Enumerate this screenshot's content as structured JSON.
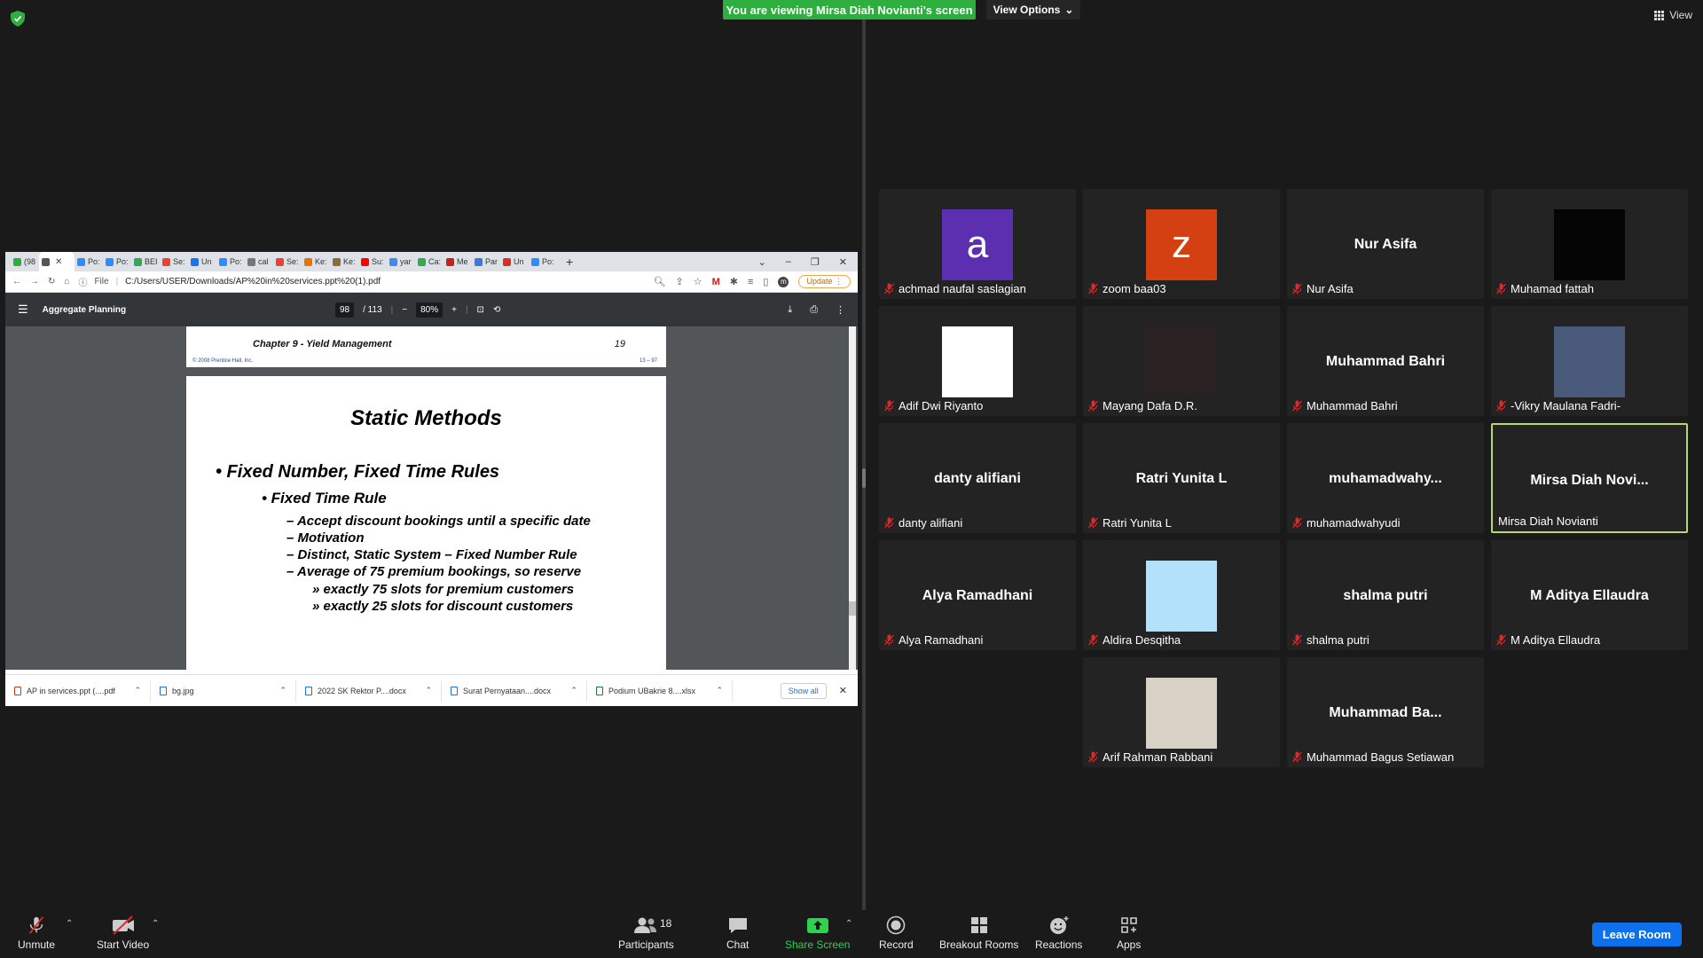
{
  "banner": {
    "viewing_text": "You are viewing Mirsa Diah Novianti's screen",
    "view_options_label": "View Options",
    "view_label": "View"
  },
  "browser": {
    "tabs": [
      {
        "label": "(98",
        "color": "#2dae3e"
      },
      {
        "label": "",
        "color": "#555555"
      },
      {
        "label": "Po:",
        "color": "#2d8cff"
      },
      {
        "label": "Po:",
        "color": "#2d8cff"
      },
      {
        "label": "BEI",
        "color": "#34a853"
      },
      {
        "label": "Se:",
        "color": "#ea4335"
      },
      {
        "label": "Un",
        "color": "#1a73e8"
      },
      {
        "label": "Po:",
        "color": "#2d8cff"
      },
      {
        "label": "cal",
        "color": "#777777"
      },
      {
        "label": "Se:",
        "color": "#ea4335"
      },
      {
        "label": "Ke:",
        "color": "#e37400"
      },
      {
        "label": "Ke:",
        "color": "#8a6d3b"
      },
      {
        "label": "Su:",
        "color": "#ff0000"
      },
      {
        "label": "yar",
        "color": "#4285f4"
      },
      {
        "label": "Ca:",
        "color": "#34a853"
      },
      {
        "label": "Me",
        "color": "#c5221f"
      },
      {
        "label": "Par",
        "color": "#3c78d8"
      },
      {
        "label": "Un",
        "color": "#d93025"
      },
      {
        "label": "Po:",
        "color": "#2d8cff"
      }
    ],
    "url_prefix": "File",
    "url": "C:/Users/USER/Downloads/AP%20in%20services.ppt%20(1).pdf",
    "update_label": "Update",
    "pdf": {
      "title": "Aggregate Planning",
      "page_current": "98",
      "page_total": "/ 113",
      "zoom": "80%",
      "prev_page": {
        "chapter": "Chapter 9 - Yield Management",
        "number": "19",
        "copyright": "© 2008 Prentice Hall, Inc.",
        "page_ref": "13 – 97"
      },
      "slide": {
        "title": "Static Methods",
        "bullet1": "•  Fixed Number, Fixed Time Rules",
        "bullet2": "•  Fixed Time Rule",
        "sub_items": [
          "– Accept discount bookings until a specific date",
          "– Motivation",
          "– Distinct, Static System – Fixed Number Rule",
          "– Average of 75 premium bookings, so reserve"
        ],
        "sub_sub_items": [
          "» exactly 75 slots for premium customers",
          "» exactly 25 slots for discount customers"
        ]
      }
    },
    "downloads": [
      {
        "name": "AP in services.ppt (....pdf",
        "color": "#d93025"
      },
      {
        "name": "bg.jpg",
        "color": "#1a73e8"
      },
      {
        "name": "2022 SK Rektor P....docx",
        "color": "#1a73e8"
      },
      {
        "name": "Surat Pernyataan....docx",
        "color": "#1a73e8"
      },
      {
        "name": "Podium UBakrie 8....xlsx",
        "color": "#188038"
      }
    ],
    "show_all_label": "Show all"
  },
  "participants": [
    {
      "name": "achmad naufal saslagian",
      "avatar": "letter",
      "letter": "a",
      "color": "#5b2fb0"
    },
    {
      "name": "zoom baa03",
      "avatar": "letter",
      "letter": "z",
      "color": "#d44012"
    },
    {
      "name": "Nur Asifa",
      "avatar": "name",
      "big": "Nur Asifa"
    },
    {
      "name": "Muhamad fattah",
      "avatar": "image",
      "color": "#050505"
    },
    {
      "name": "Adif Dwi Riyanto",
      "avatar": "image",
      "color": "#ffffff"
    },
    {
      "name": "Mayang Dafa D.R.",
      "avatar": "image",
      "color": "#2a2222"
    },
    {
      "name": "Muhammad Bahri",
      "avatar": "name",
      "big": "Muhammad Bahri"
    },
    {
      "name": "-Vikry Maulana Fadri-",
      "avatar": "image",
      "color": "#4a5a7a"
    },
    {
      "name": "danty alifiani",
      "avatar": "name",
      "big": "danty alifiani"
    },
    {
      "name": "Ratri Yunita L",
      "avatar": "name",
      "big": "Ratri Yunita L"
    },
    {
      "name": "muhamadwahyudi",
      "avatar": "name",
      "big": "muhamadwahy..."
    },
    {
      "name": "Mirsa Diah Novianti",
      "avatar": "name",
      "big": "Mirsa  Diah  Novi...",
      "active": true
    },
    {
      "name": "Alya Ramadhani",
      "avatar": "name",
      "big": "Alya Ramadhani"
    },
    {
      "name": "Aldira Desqitha",
      "avatar": "image",
      "color": "#b3e0fb"
    },
    {
      "name": "shalma putri",
      "avatar": "name",
      "big": "shalma putri"
    },
    {
      "name": "M Aditya Ellaudra",
      "avatar": "name",
      "big": "M Aditya Ellaudra"
    },
    {
      "name": "Arif Rahman Rabbani",
      "avatar": "image",
      "color": "#d8d2c6"
    },
    {
      "name": "Muhammad Bagus Setiawan",
      "avatar": "name",
      "big": "Muhammad  Ba..."
    }
  ],
  "toolbar": {
    "unmute": "Unmute",
    "start_video": "Start Video",
    "participants": "Participants",
    "participants_count": "18",
    "chat": "Chat",
    "share_screen": "Share Screen",
    "record": "Record",
    "breakout": "Breakout Rooms",
    "reactions": "Reactions",
    "apps": "Apps",
    "leave": "Leave Room"
  }
}
